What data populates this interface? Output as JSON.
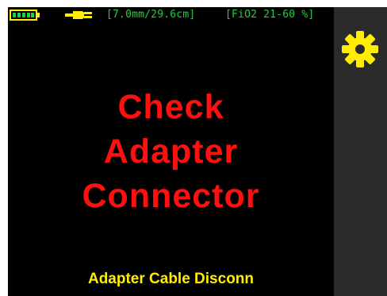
{
  "status_bar": {
    "battery_icon": "battery-full-icon",
    "power_icon": "power-plug-icon",
    "tube_size": "[7.0mm/29.6cm]",
    "fio2_range": "[FiO2 21-60 %]"
  },
  "side_panel": {
    "settings_icon": "gear-icon"
  },
  "alert": {
    "line1": "Check",
    "line2": "Adapter",
    "line3": "Connector"
  },
  "footer": {
    "status_text": "Adapter Cable Disconn"
  },
  "colors": {
    "background": "#000000",
    "panel": "#2b2b2b",
    "status_green": "#22cc44",
    "alert_red": "#ff1010",
    "accent_yellow": "#ffee00"
  }
}
